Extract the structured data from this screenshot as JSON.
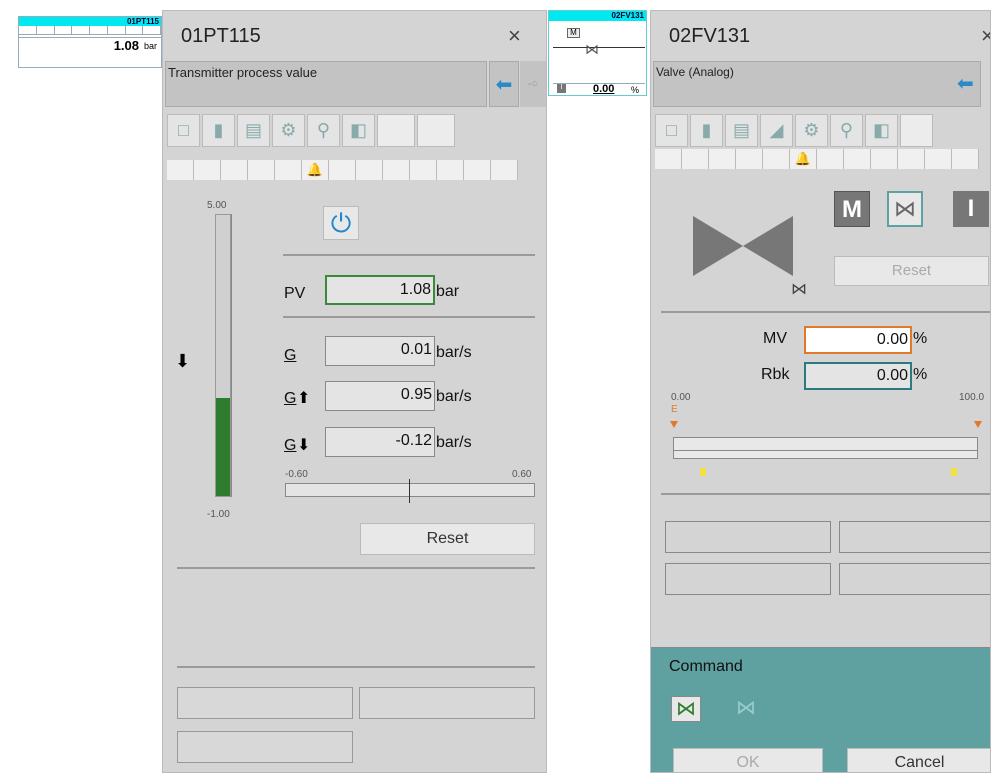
{
  "pt_block": {
    "tag": "01PT115",
    "value": "1.08",
    "unit": "bar"
  },
  "fv_block": {
    "tag": "02FV131",
    "mode_letter": "M",
    "status_letter": "I",
    "value": "0.00",
    "unit": "%"
  },
  "pt_face": {
    "title": "01PT115",
    "close": "×",
    "description": "Transmitter process value",
    "scale_max": "5.00",
    "scale_min": "-1.00",
    "bar_fill_fraction": 0.35,
    "pv_label": "PV",
    "pv_value": "1.08",
    "pv_unit": "bar",
    "g_label": "G",
    "g_value": "0.01",
    "g_unit": "bar/s",
    "gup_label": "G",
    "gup_value": "0.95",
    "gup_unit": "bar/s",
    "gdn_label": "G",
    "gdn_value": "-0.12",
    "gdn_unit": "bar/s",
    "grad_min": "-0.60",
    "grad_max": "0.60",
    "reset": "Reset"
  },
  "fv_face": {
    "title": "02FV131",
    "close": "×",
    "description": "Valve (Analog)",
    "mode_m": "M",
    "mode_i": "I",
    "reset": "Reset",
    "mv_label": "MV",
    "mv_value": "0.00",
    "mv_unit": "%",
    "rbk_label": "Rbk",
    "rbk_value": "0.00",
    "rbk_unit": "%",
    "scale_min": "0.00",
    "scale_max": "100.0",
    "scale_e": "E",
    "command": "Command",
    "ok": "OK",
    "cancel": "Cancel"
  },
  "colors": {
    "cyan_header": "#00e8f0",
    "pv_border": "#3a8a3a",
    "mv_border": "#e07a2a",
    "rbk_border": "#2a7a80",
    "bar_green": "#2e7d2e",
    "command_bg": "#5fa0a0",
    "power_icon": "#2288cc"
  }
}
